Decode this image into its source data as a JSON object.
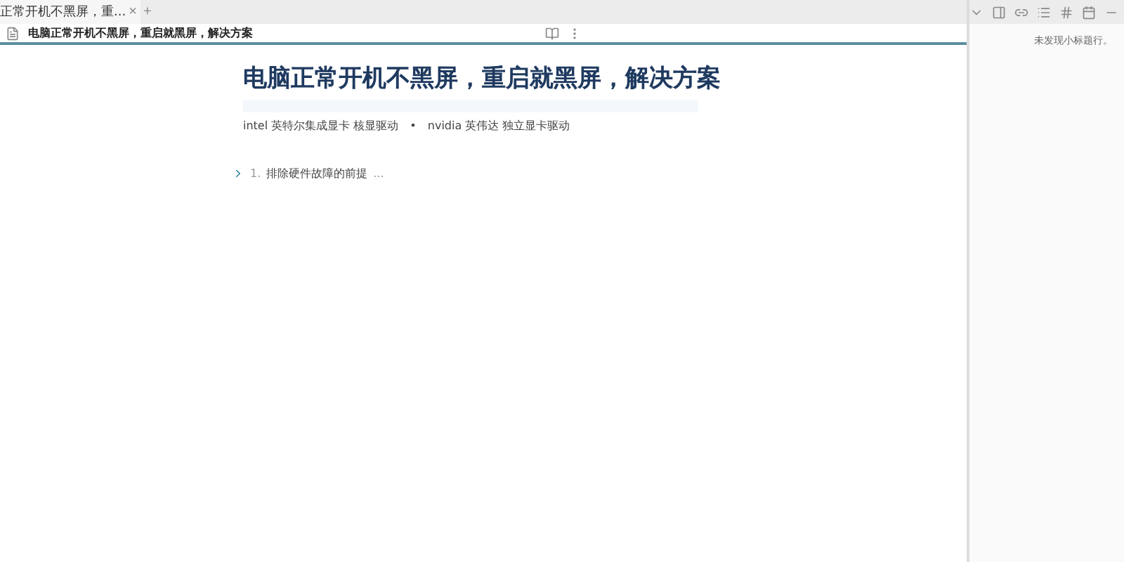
{
  "tab": {
    "title": "正常开机不黑屏，重...",
    "close": "×"
  },
  "new_tab": "+",
  "document": {
    "title": "电脑正常开机不黑屏，重启就黑屏，解决方案"
  },
  "heading": "电脑正常开机不黑屏，重启就黑屏，解决方案",
  "links": [
    {
      "text": "intel 英特尔集成显卡 核显驱动"
    },
    {
      "text": "•"
    },
    {
      "text": "nvidia 英伟达 独立显卡驱动"
    }
  ],
  "outline": [
    {
      "number": "1.",
      "text": "排除硬件故障的前提",
      "ellipsis": "...",
      "expanded": false
    }
  ],
  "sidebar": {
    "message": "未发现小标题行。"
  }
}
